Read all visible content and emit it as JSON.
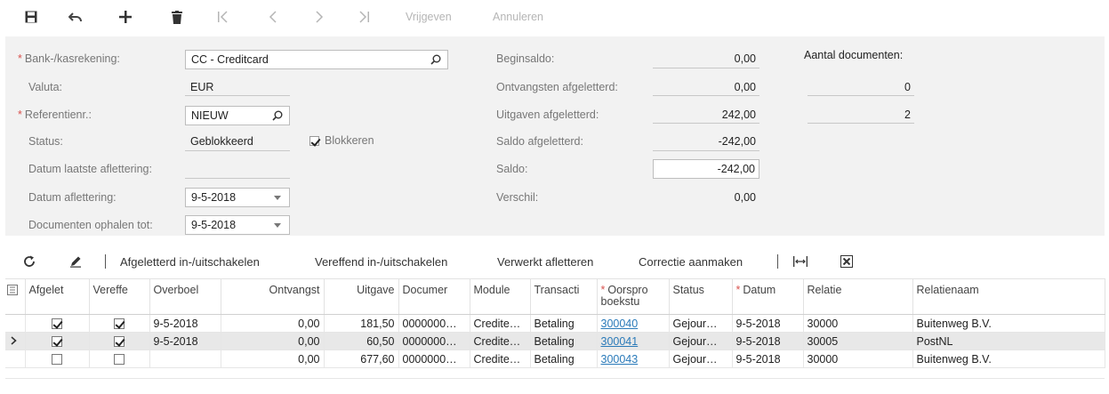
{
  "toolbar": {
    "save_icon": "save-icon",
    "undo_icon": "undo-icon",
    "add_icon": "plus-icon",
    "delete_icon": "trash-icon",
    "first_icon": "first-page-icon",
    "prev_icon": "previous-icon",
    "next_icon": "next-icon",
    "last_icon": "last-page-icon",
    "release_label": "Vrijgeven",
    "cancel_label": "Annuleren"
  },
  "form": {
    "bank_account": {
      "label": "Bank-/kasrekening:",
      "value": "CC - Creditcard"
    },
    "currency": {
      "label": "Valuta:",
      "value": "EUR"
    },
    "reference": {
      "label": "Referentienr.:",
      "value": "NIEUW"
    },
    "status": {
      "label": "Status:",
      "value": "Geblokkeerd",
      "hold_label": "Blokkeren",
      "hold_checked": true
    },
    "last_reconciliation": {
      "label": "Datum laatste aflettering:",
      "value": ""
    },
    "reconciliation_date": {
      "label": "Datum aflettering:",
      "value": "9-5-2018"
    },
    "load_documents_till": {
      "label": "Documenten ophalen tot:",
      "value": "9-5-2018"
    },
    "beginning_balance": {
      "label": "Beginsaldo:",
      "value": "0,00"
    },
    "receipts_cleared": {
      "label": "Ontvangsten afgeletterd:",
      "value": "0,00",
      "count": "0"
    },
    "disbursements_cleared": {
      "label": "Uitgaven afgeletterd:",
      "value": "242,00",
      "count": "2"
    },
    "balance_cleared": {
      "label": "Saldo afgeletterd:",
      "value": "-242,00"
    },
    "balance": {
      "label": "Saldo:",
      "value": "-242,00"
    },
    "difference": {
      "label": "Verschil:",
      "value": "0,00"
    },
    "doc_count_header": "Aantal documenten:"
  },
  "grid_toolbar": {
    "refresh_icon": "refresh-icon",
    "edit_icon": "pencil-icon",
    "toggle_reconciled": "Afgeletterd in-/uitschakelen",
    "toggle_cleared": "Vereffend in-/uitschakelen",
    "process_reconciliation": "Verwerkt afletteren",
    "create_adjustment": "Correctie aanmaken",
    "fit_icon": "fit-columns-icon",
    "excel_icon": "excel-export-icon"
  },
  "grid": {
    "columns": {
      "reconciled": "Afgelet",
      "cleared": "Vereffe",
      "cleared_date": "Overboel",
      "receipt": "Ontvangst",
      "disbursement": "Uitgave",
      "document": "Documer",
      "module": "Module",
      "tran_type": "Transacti",
      "orig_batch": "Oorspro boekstu",
      "status": "Status",
      "date": "Datum",
      "customer": "Relatie",
      "customer_name": "Relatienaam"
    },
    "rows": [
      {
        "reconciled": true,
        "cleared": true,
        "cleared_date": "9-5-2018",
        "receipt": "0,00",
        "disbursement": "181,50",
        "document": "0000000…",
        "module": "Credite…",
        "tran_type": "Betaling",
        "orig_batch": "300040",
        "status": "Gejour…",
        "date": "9-5-2018",
        "customer": "30000",
        "customer_name": "Buitenweg B.V."
      },
      {
        "reconciled": true,
        "cleared": true,
        "cleared_date": "9-5-2018",
        "receipt": "0,00",
        "disbursement": "60,50",
        "document": "0000000…",
        "module": "Credite…",
        "tran_type": "Betaling",
        "orig_batch": "300041",
        "status": "Gejour…",
        "date": "9-5-2018",
        "customer": "30005",
        "customer_name": "PostNL"
      },
      {
        "reconciled": false,
        "cleared": false,
        "cleared_date": "",
        "receipt": "0,00",
        "disbursement": "677,60",
        "document": "0000000…",
        "module": "Credite…",
        "tran_type": "Betaling",
        "orig_batch": "300043",
        "status": "Gejour…",
        "date": "9-5-2018",
        "customer": "30000",
        "customer_name": "Buitenweg B.V."
      }
    ],
    "selected_row": 1
  },
  "colors": {
    "link": "#2a7ab9",
    "required_marker": "#d9534f",
    "panel_background": "#f2f2f2"
  }
}
